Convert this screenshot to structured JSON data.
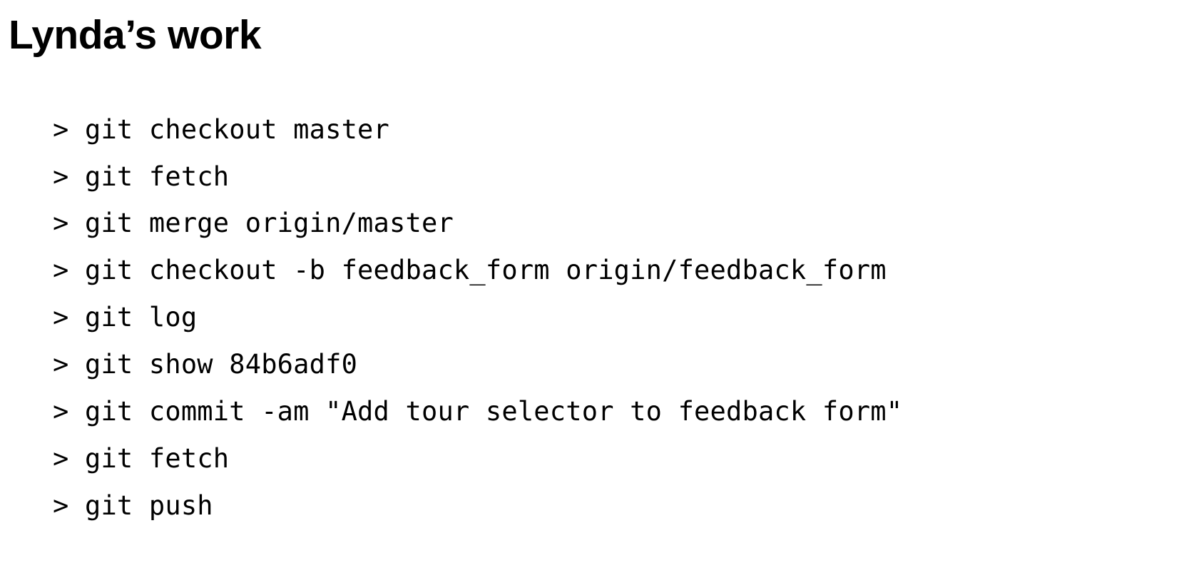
{
  "heading": "Lynda’s work",
  "prompt": ">",
  "commands": [
    "git checkout master",
    "git fetch",
    "git merge origin/master",
    "git checkout -b feedback_form origin/feedback_form",
    "git log",
    "git show 84b6adf0",
    "git commit -am \"Add tour selector to feedback form\"",
    "git fetch",
    "git push"
  ]
}
